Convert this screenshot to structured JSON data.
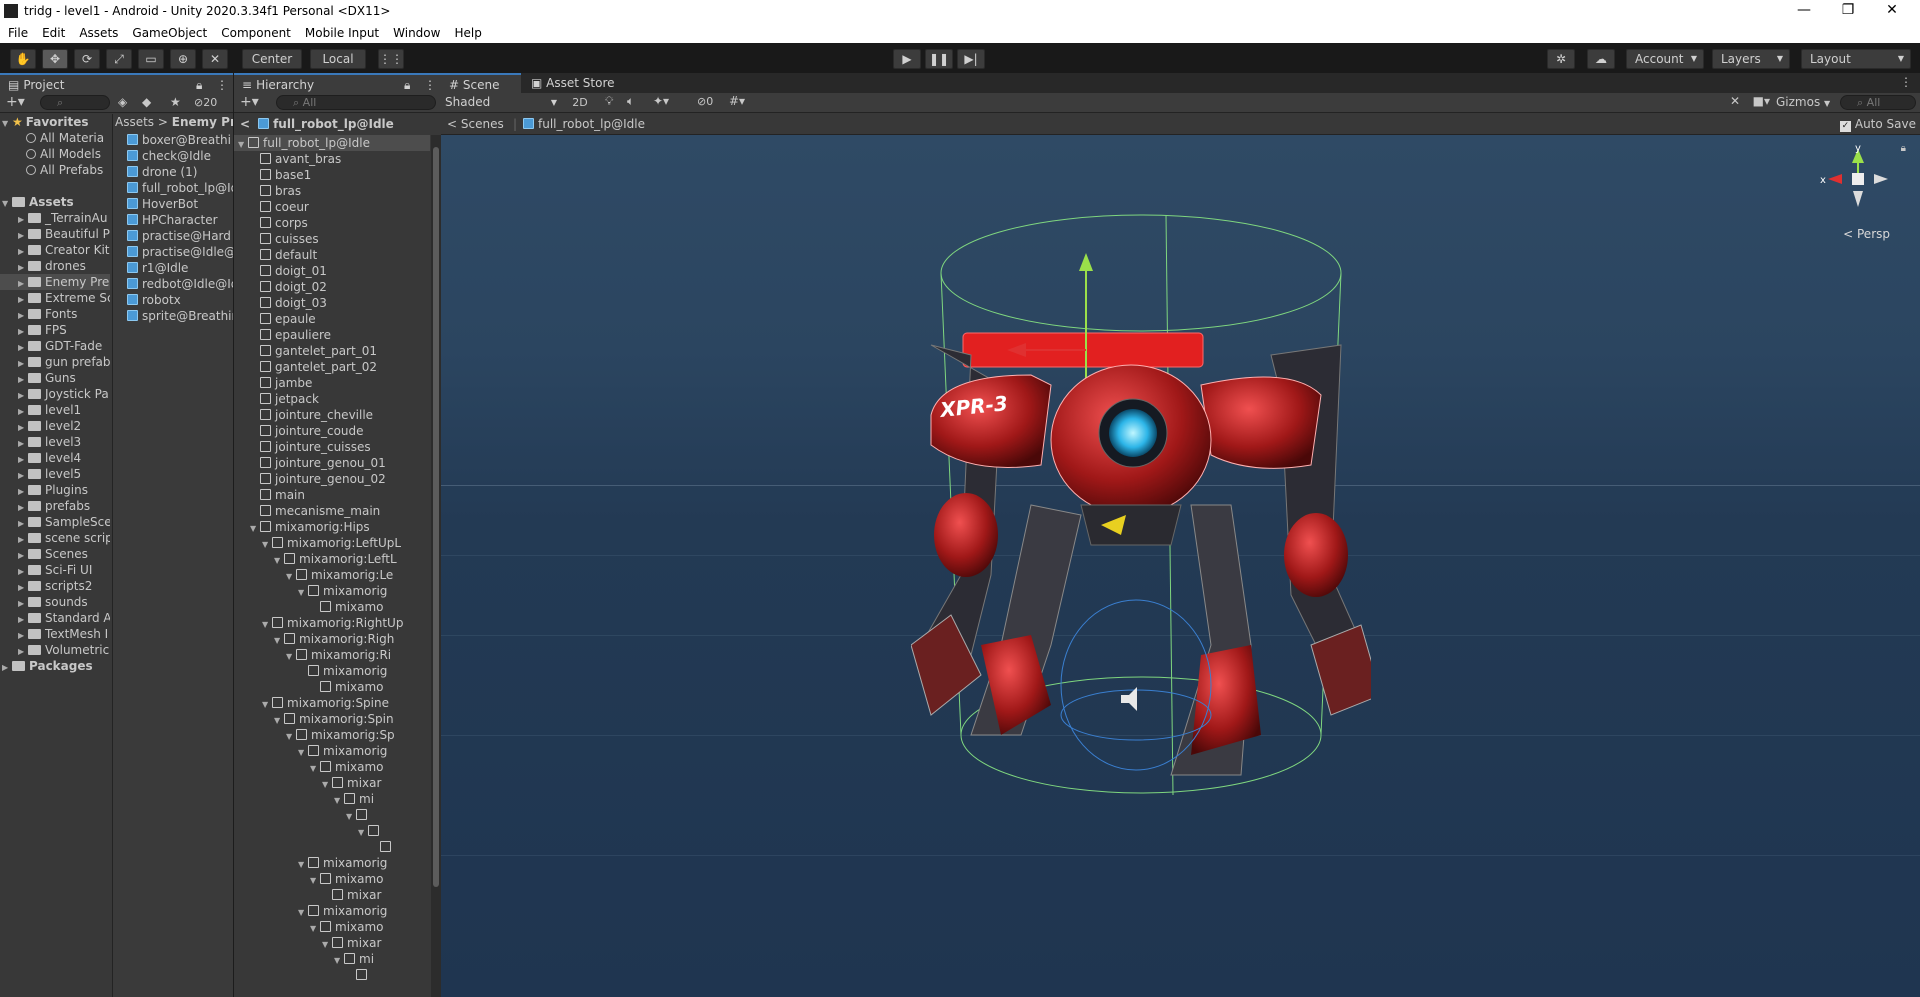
{
  "window": {
    "title": "tridg - level1 - Android - Unity 2020.3.34f1 Personal <DX11>",
    "controls": [
      "—",
      "❐",
      "✕"
    ]
  },
  "menu": [
    "File",
    "Edit",
    "Assets",
    "GameObject",
    "Component",
    "Mobile Input",
    "Window",
    "Help"
  ],
  "toolbar": {
    "pivot_mode": "Center",
    "pivot_rotation": "Local",
    "account_label": "Account",
    "layers_label": "Layers",
    "layout_label": "Layout"
  },
  "project": {
    "tab": "Project",
    "visibility_count": "20",
    "favorites_label": "Favorites",
    "favorites": [
      "All Materia",
      "All Models",
      "All Prefabs"
    ],
    "assets_label": "Assets",
    "folders": [
      "_TerrainAu",
      "Beautiful P",
      "Creator Kit",
      "drones",
      "Enemy Pre",
      "Extreme Sc",
      "Fonts",
      "FPS",
      "GDT-Fade",
      "gun prefab",
      "Guns",
      "Joystick Pa",
      "level1",
      "level2",
      "level3",
      "level4",
      "level5",
      "Plugins",
      "prefabs",
      "SampleSce",
      "scene scrip",
      "Scenes",
      "Sci-Fi UI",
      "scripts2",
      "sounds",
      "Standard A",
      "TextMesh I",
      "Volumetric"
    ],
    "packages_label": "Packages",
    "breadcrumb": [
      "Assets",
      ">",
      "Enemy Pre"
    ],
    "files": [
      "boxer@Breathi",
      "check@Idle",
      "drone (1)",
      "full_robot_lp@Id",
      "HoverBot",
      "HPCharacter",
      "practise@Hard",
      "practise@Idle@",
      "r1@Idle",
      "redbot@Idle@Id",
      "robotx",
      "sprite@Breathin"
    ]
  },
  "hierarchy": {
    "tab": "Hierarchy",
    "search_placeholder": "All",
    "header": "full_robot_lp@Idle",
    "rows": [
      {
        "label": "full_robot_lp@Idle",
        "indent": 0,
        "arrow": "▼"
      },
      {
        "label": "avant_bras",
        "indent": 1,
        "arrow": ""
      },
      {
        "label": "base1",
        "indent": 1,
        "arrow": ""
      },
      {
        "label": "bras",
        "indent": 1,
        "arrow": ""
      },
      {
        "label": "coeur",
        "indent": 1,
        "arrow": ""
      },
      {
        "label": "corps",
        "indent": 1,
        "arrow": ""
      },
      {
        "label": "cuisses",
        "indent": 1,
        "arrow": ""
      },
      {
        "label": "default",
        "indent": 1,
        "arrow": ""
      },
      {
        "label": "doigt_01",
        "indent": 1,
        "arrow": ""
      },
      {
        "label": "doigt_02",
        "indent": 1,
        "arrow": ""
      },
      {
        "label": "doigt_03",
        "indent": 1,
        "arrow": ""
      },
      {
        "label": "epaule",
        "indent": 1,
        "arrow": ""
      },
      {
        "label": "epauliere",
        "indent": 1,
        "arrow": ""
      },
      {
        "label": "gantelet_part_01",
        "indent": 1,
        "arrow": ""
      },
      {
        "label": "gantelet_part_02",
        "indent": 1,
        "arrow": ""
      },
      {
        "label": "jambe",
        "indent": 1,
        "arrow": ""
      },
      {
        "label": "jetpack",
        "indent": 1,
        "arrow": ""
      },
      {
        "label": "jointure_cheville",
        "indent": 1,
        "arrow": ""
      },
      {
        "label": "jointure_coude",
        "indent": 1,
        "arrow": ""
      },
      {
        "label": "jointure_cuisses",
        "indent": 1,
        "arrow": ""
      },
      {
        "label": "jointure_genou_01",
        "indent": 1,
        "arrow": ""
      },
      {
        "label": "jointure_genou_02",
        "indent": 1,
        "arrow": ""
      },
      {
        "label": "main",
        "indent": 1,
        "arrow": ""
      },
      {
        "label": "mecanisme_main",
        "indent": 1,
        "arrow": ""
      },
      {
        "label": "mixamorig:Hips",
        "indent": 1,
        "arrow": "▼"
      },
      {
        "label": "mixamorig:LeftUpL",
        "indent": 2,
        "arrow": "▼"
      },
      {
        "label": "mixamorig:LeftL",
        "indent": 3,
        "arrow": "▼"
      },
      {
        "label": "mixamorig:Le",
        "indent": 4,
        "arrow": "▼"
      },
      {
        "label": "mixamorig",
        "indent": 5,
        "arrow": "▼"
      },
      {
        "label": "mixamo",
        "indent": 6,
        "arrow": ""
      },
      {
        "label": "mixamorig:RightUp",
        "indent": 2,
        "arrow": "▼"
      },
      {
        "label": "mixamorig:Righ",
        "indent": 3,
        "arrow": "▼"
      },
      {
        "label": "mixamorig:Ri",
        "indent": 4,
        "arrow": "▼"
      },
      {
        "label": "mixamorig",
        "indent": 5,
        "arrow": ""
      },
      {
        "label": "mixamo",
        "indent": 6,
        "arrow": ""
      },
      {
        "label": "mixamorig:Spine",
        "indent": 2,
        "arrow": "▼"
      },
      {
        "label": "mixamorig:Spin",
        "indent": 3,
        "arrow": "▼"
      },
      {
        "label": "mixamorig:Sp",
        "indent": 4,
        "arrow": "▼"
      },
      {
        "label": "mixamorig",
        "indent": 5,
        "arrow": "▼"
      },
      {
        "label": "mixamo",
        "indent": 6,
        "arrow": "▼"
      },
      {
        "label": "mixar",
        "indent": 7,
        "arrow": "▼"
      },
      {
        "label": "mi",
        "indent": 8,
        "arrow": "▼"
      },
      {
        "label": "",
        "indent": 9,
        "arrow": "▼"
      },
      {
        "label": "",
        "indent": 10,
        "arrow": "▼"
      },
      {
        "label": "",
        "indent": 11,
        "arrow": ""
      },
      {
        "label": "mixamorig",
        "indent": 5,
        "arrow": "▼"
      },
      {
        "label": "mixamo",
        "indent": 6,
        "arrow": "▼"
      },
      {
        "label": "mixar",
        "indent": 7,
        "arrow": ""
      },
      {
        "label": "mixamorig",
        "indent": 5,
        "arrow": "▼"
      },
      {
        "label": "mixamo",
        "indent": 6,
        "arrow": "▼"
      },
      {
        "label": "mixar",
        "indent": 7,
        "arrow": "▼"
      },
      {
        "label": "mi",
        "indent": 8,
        "arrow": "▼"
      },
      {
        "label": "",
        "indent": 9,
        "arrow": ""
      }
    ]
  },
  "scene": {
    "tab_scene": "Scene",
    "tab_asset_store": "Asset Store",
    "shading": "Shaded",
    "mode_2d": "2D",
    "hidden_count": "0",
    "gizmos_label": "Gizmos",
    "search_placeholder": "All",
    "breadcrumb_root": "Scenes",
    "breadcrumb_item": "full_robot_lp@Idle",
    "auto_save_label": "Auto Save",
    "projection_label": "Persp",
    "axis_x": "x",
    "axis_y": "y",
    "robot_decal": "XPR-3"
  }
}
